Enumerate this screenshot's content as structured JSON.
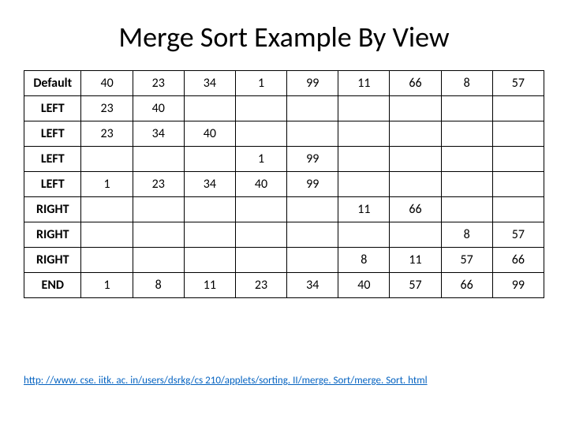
{
  "title": "Merge Sort Example By View",
  "chart_data": {
    "type": "table",
    "headers": [
      "",
      "",
      "",
      "",
      "",
      "",
      "",
      "",
      "",
      ""
    ],
    "rows": [
      {
        "label": "Default",
        "cells": [
          "40",
          "23",
          "34",
          "1",
          "99",
          "11",
          "66",
          "8",
          "57"
        ]
      },
      {
        "label": "LEFT",
        "cells": [
          "23",
          "40",
          "",
          "",
          "",
          "",
          "",
          "",
          ""
        ]
      },
      {
        "label": "LEFT",
        "cells": [
          "23",
          "34",
          "40",
          "",
          "",
          "",
          "",
          "",
          ""
        ]
      },
      {
        "label": "LEFT",
        "cells": [
          "",
          "",
          "",
          "1",
          "99",
          "",
          "",
          "",
          ""
        ]
      },
      {
        "label": "LEFT",
        "cells": [
          "1",
          "23",
          "34",
          "40",
          "99",
          "",
          "",
          "",
          ""
        ]
      },
      {
        "label": "RIGHT",
        "cells": [
          "",
          "",
          "",
          "",
          "",
          "11",
          "66",
          "",
          ""
        ]
      },
      {
        "label": "RIGHT",
        "cells": [
          "",
          "",
          "",
          "",
          "",
          "",
          "",
          "8",
          "57"
        ]
      },
      {
        "label": "RIGHT",
        "cells": [
          "",
          "",
          "",
          "",
          "",
          "8",
          "11",
          "57",
          "66"
        ]
      },
      {
        "label": "END",
        "cells": [
          "1",
          "8",
          "11",
          "23",
          "34",
          "40",
          "57",
          "66",
          "99"
        ]
      }
    ]
  },
  "footer_link": "http: //www. cse. iitk. ac. in/users/dsrkg/cs 210/applets/sorting. II/merge. Sort/merge. Sort. html"
}
